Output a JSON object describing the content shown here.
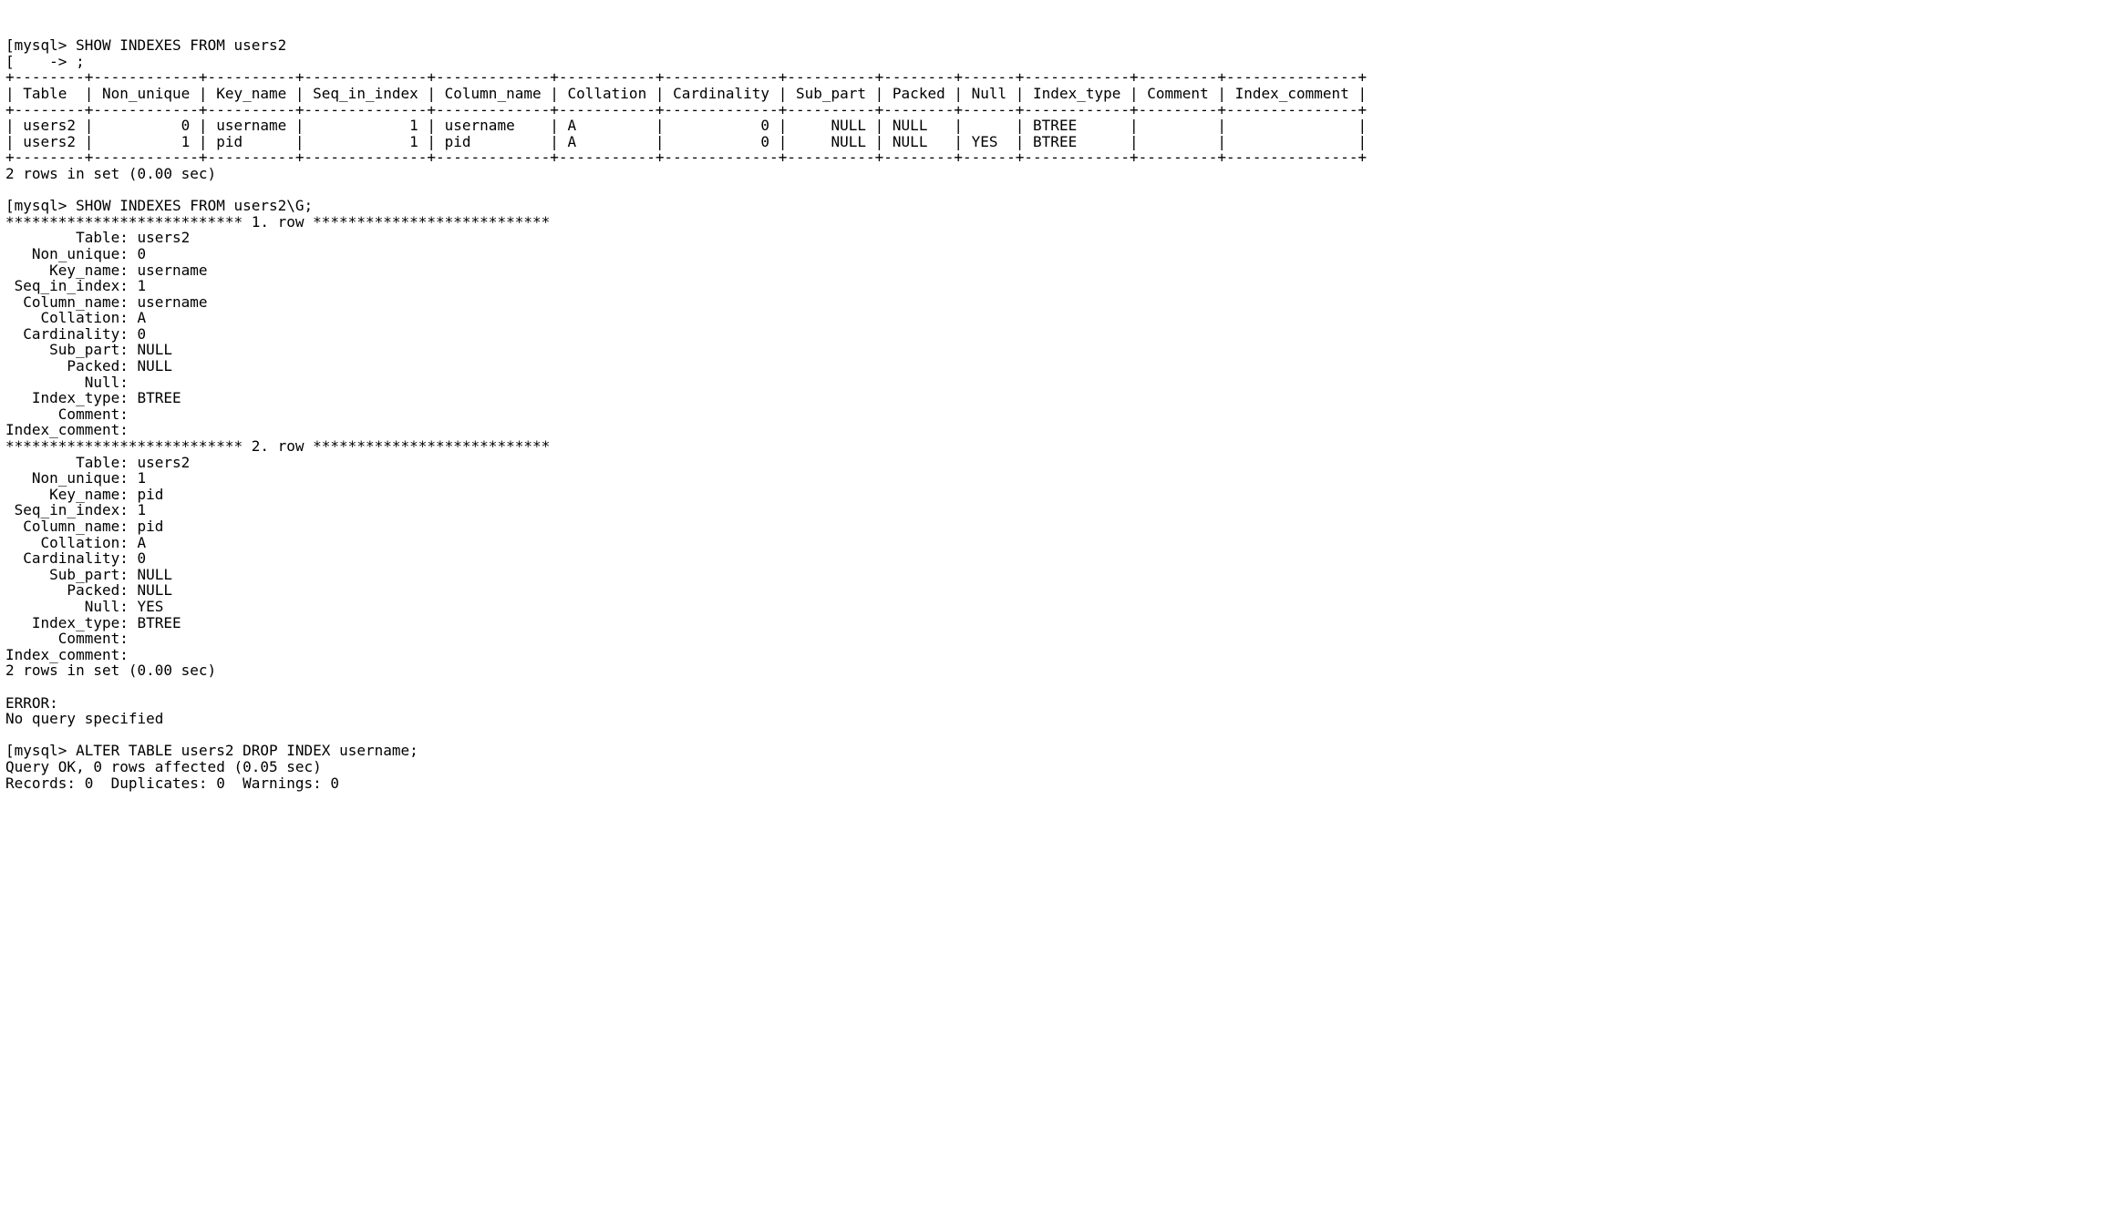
{
  "prompt": "mysql>",
  "contPrompt": "    ->",
  "cmd1": "SHOW INDEXES FROM users2",
  "cmd1b": ";",
  "tableBorder": "+--------+------------+----------+--------------+-------------+-----------+-------------+----------+--------+------+------------+---------+---------------+",
  "tableHeader": "| Table  | Non_unique | Key_name | Seq_in_index | Column_name | Collation | Cardinality | Sub_part | Packed | Null | Index_type | Comment | Index_comment |",
  "tableRow1": "| users2 |          0 | username |            1 | username    | A         |           0 |     NULL | NULL   |      | BTREE      |         |               |",
  "tableRow2": "| users2 |          1 | pid      |            1 | pid         | A         |           0 |     NULL | NULL   | YES  | BTREE      |         |               |",
  "rowsMsg1": "2 rows in set (0.00 sec)",
  "cmd2": "SHOW INDEXES FROM users2\\G;",
  "rowSep1": "*************************** 1. row ***************************",
  "rowSep2": "*************************** 2. row ***************************",
  "fields": [
    {
      "label": "        Table:",
      "v1": "users2",
      "v2": "users2"
    },
    {
      "label": "   Non_unique:",
      "v1": "0",
      "v2": "1"
    },
    {
      "label": "     Key_name:",
      "v1": "username",
      "v2": "pid"
    },
    {
      "label": " Seq_in_index:",
      "v1": "1",
      "v2": "1"
    },
    {
      "label": "  Column_name:",
      "v1": "username",
      "v2": "pid"
    },
    {
      "label": "    Collation:",
      "v1": "A",
      "v2": "A"
    },
    {
      "label": "  Cardinality:",
      "v1": "0",
      "v2": "0"
    },
    {
      "label": "     Sub_part:",
      "v1": "NULL",
      "v2": "NULL"
    },
    {
      "label": "       Packed:",
      "v1": "NULL",
      "v2": "NULL"
    },
    {
      "label": "         Null:",
      "v1": "",
      "v2": "YES"
    },
    {
      "label": "   Index_type:",
      "v1": "BTREE",
      "v2": "BTREE"
    },
    {
      "label": "      Comment:",
      "v1": "",
      "v2": ""
    },
    {
      "label": "Index_comment:",
      "v1": "",
      "v2": ""
    }
  ],
  "rowsMsg2": "2 rows in set (0.00 sec)",
  "errorLine": "ERROR:",
  "errorMsg": "No query specified",
  "cmd3": "ALTER TABLE users2 DROP INDEX username;",
  "result3a": "Query OK, 0 rows affected (0.05 sec)",
  "result3b": "Records: 0  Duplicates: 0  Warnings: 0"
}
